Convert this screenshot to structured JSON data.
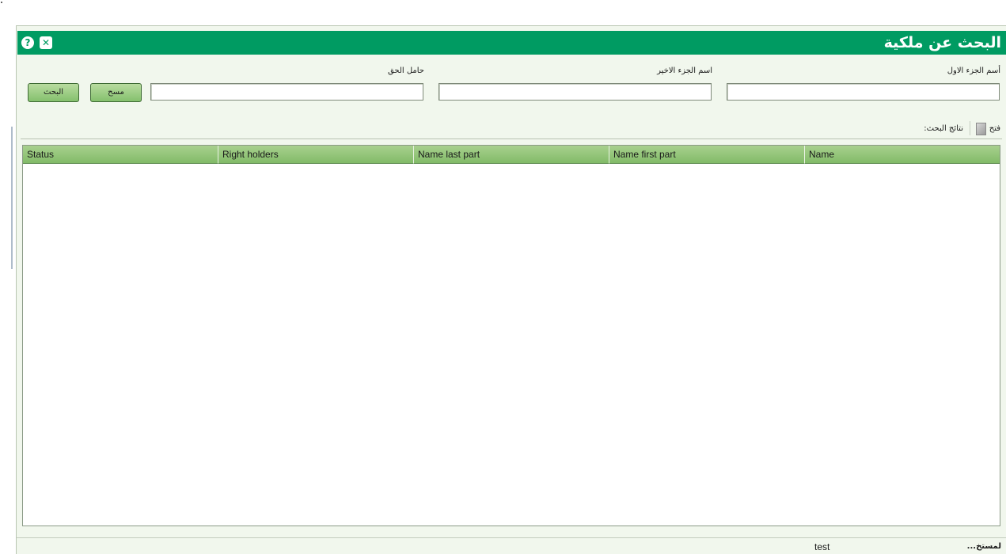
{
  "window": {
    "title": "البحث عن ملكية",
    "help_icon": "help-icon",
    "close_icon": "close-icon",
    "help_glyph": "?",
    "close_glyph": "✕"
  },
  "form": {
    "first_name_label": "أسم الجزء الاول",
    "last_name_label": "اسم الجزء الاخير",
    "right_holder_label": "حامل الحق",
    "first_name_value": "",
    "last_name_value": "",
    "right_holder_value": "",
    "clear_button": "مسح",
    "search_button": "البحث"
  },
  "results": {
    "open_label": "فتح",
    "open_icon": "document-icon",
    "results_label": "نتائج البحث:",
    "columns": [
      "Status",
      "Right holders",
      "Name last part",
      "Name first part",
      "Name"
    ],
    "rows": []
  },
  "status_bar": {
    "user_label": "لمستخ...",
    "user_value": "test"
  },
  "colors": {
    "title_bar": "#009b62",
    "background": "#f1f7ed",
    "header": "#8cc274"
  }
}
